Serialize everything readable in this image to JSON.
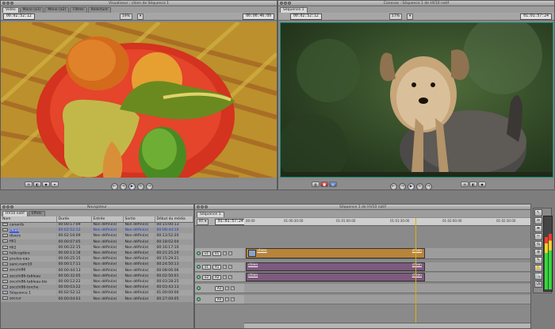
{
  "viewer": {
    "title": "Visualiseur : chien de Séquence 1",
    "tabs": [
      "Vidéo",
      "Mono (a1)",
      "Mono (a2)",
      "Filtres",
      "Relecture"
    ],
    "timecode_left": "00:02:52:12",
    "zoom": "19%",
    "view_menu": "▾",
    "timecode_right": "00:00:46:09"
  },
  "canvas": {
    "title": "Canevas : Séquence 1 de HV10 natif",
    "tabs": [
      "Séquence 1"
    ],
    "timecode_left": "00:02:52:12",
    "zoom": "17%",
    "view_menu": "▾",
    "timecode_right": "01:01:57:24"
  },
  "browser": {
    "title": "Navigateur",
    "tabs": [
      "HV10 natif",
      "Effets"
    ],
    "columns": [
      "Nom",
      "Durée",
      "Entrée",
      "Sortie",
      "Début du média"
    ],
    "rows": [
      {
        "name": "canards",
        "duration": "00:00:17:09",
        "in": "Non défini(e)",
        "out": "Non défini(e)",
        "start": "00:15:00:13",
        "selected": false,
        "icon": "clip"
      },
      {
        "name": "chien",
        "duration": "00:02:52:12",
        "in": "Non défini(e)",
        "out": "Non défini(e)",
        "start": "00:08:44:10",
        "selected": true,
        "icon": "clip"
      },
      {
        "name": "divers",
        "duration": "00:02:16:09",
        "in": "Non défini(e)",
        "out": "Non défini(e)",
        "start": "00:13:52:20",
        "selected": false,
        "icon": "clip"
      },
      {
        "name": "fill1",
        "duration": "00:00:07:05",
        "in": "Non défini(e)",
        "out": "Non défini(e)",
        "start": "00:18:02:04",
        "selected": false,
        "icon": "clip"
      },
      {
        "name": "fill2",
        "duration": "00:00:22:15",
        "in": "Non défini(e)",
        "out": "Non défini(e)",
        "start": "00:16:17:10",
        "selected": false,
        "icon": "clip"
      },
      {
        "name": "hélicoptère",
        "duration": "00:00:13:18",
        "in": "Non défini(e)",
        "out": "Non défini(e)",
        "start": "00:21:25:20",
        "selected": false,
        "icon": "clip"
      },
      {
        "name": "poules-eau",
        "duration": "00:00:25:15",
        "in": "Non défini(e)",
        "out": "Non défini(e)",
        "start": "00:15:29:21",
        "selected": false,
        "icon": "clip"
      },
      {
        "name": "sanc-nam10",
        "duration": "00:00:17:11",
        "in": "Non défini(e)",
        "out": "Non défini(e)",
        "start": "00:24:50:13",
        "selected": false,
        "icon": "clip"
      },
      {
        "name": "zocchi86",
        "duration": "00:00:44:13",
        "in": "Non défini(e)",
        "out": "Non défini(e)",
        "start": "00:08:06:06",
        "selected": false,
        "icon": "clip"
      },
      {
        "name": "zocchi86-tableau",
        "duration": "00:00:32:05",
        "in": "Non défini(e)",
        "out": "Non défini(e)",
        "start": "00:02:50:01",
        "selected": false,
        "icon": "clip"
      },
      {
        "name": "zocchi86-tableau-bis",
        "duration": "00:00:12:22",
        "in": "Non défini(e)",
        "out": "Non défini(e)",
        "start": "00:03:28:25",
        "selected": false,
        "icon": "clip"
      },
      {
        "name": "zocchi86-torche",
        "duration": "00:00:03:22",
        "in": "Non défini(e)",
        "out": "Non défini(e)",
        "start": "00:03:43:13",
        "selected": false,
        "icon": "clip"
      },
      {
        "name": "Séquence 1",
        "duration": "00:02:52:12",
        "in": "Non défini(e)",
        "out": "Non défini(e)",
        "start": "01:00:00:00",
        "selected": false,
        "icon": "seq"
      },
      {
        "name": "zoccur",
        "duration": "00:00:04:03",
        "in": "Non défini(e)",
        "out": "Non défini(e)",
        "start": "00:27:09:05",
        "selected": false,
        "icon": "clip"
      }
    ]
  },
  "timeline": {
    "title": "Séquence 1 de HV10 natif",
    "tabs": [
      "Séquence 1"
    ],
    "rt_menu": "RT ▾",
    "timecode": "01:01:57:24",
    "ruler": [
      "00:00",
      "01:00:30:00",
      "01:01:00:00",
      "01:01:30:00",
      "01:02:00:00",
      "01:02:30:00",
      "01:03:00:00"
    ],
    "tracks": [
      {
        "src": "v1",
        "dst": "V1",
        "kind": "video"
      },
      {
        "src": "a1",
        "dst": "A1",
        "kind": "audio"
      },
      {
        "src": "a2",
        "dst": "A2",
        "kind": "audio"
      },
      {
        "src": "",
        "dst": "A3",
        "kind": "audio"
      },
      {
        "src": "",
        "dst": "A4",
        "kind": "audio"
      }
    ],
    "clip_label": "chien"
  },
  "tools": [
    "↖",
    "⇹",
    "⬌",
    "✂",
    "⇆",
    "⊕",
    "✎",
    "✋",
    "🔍",
    "⌫"
  ]
}
